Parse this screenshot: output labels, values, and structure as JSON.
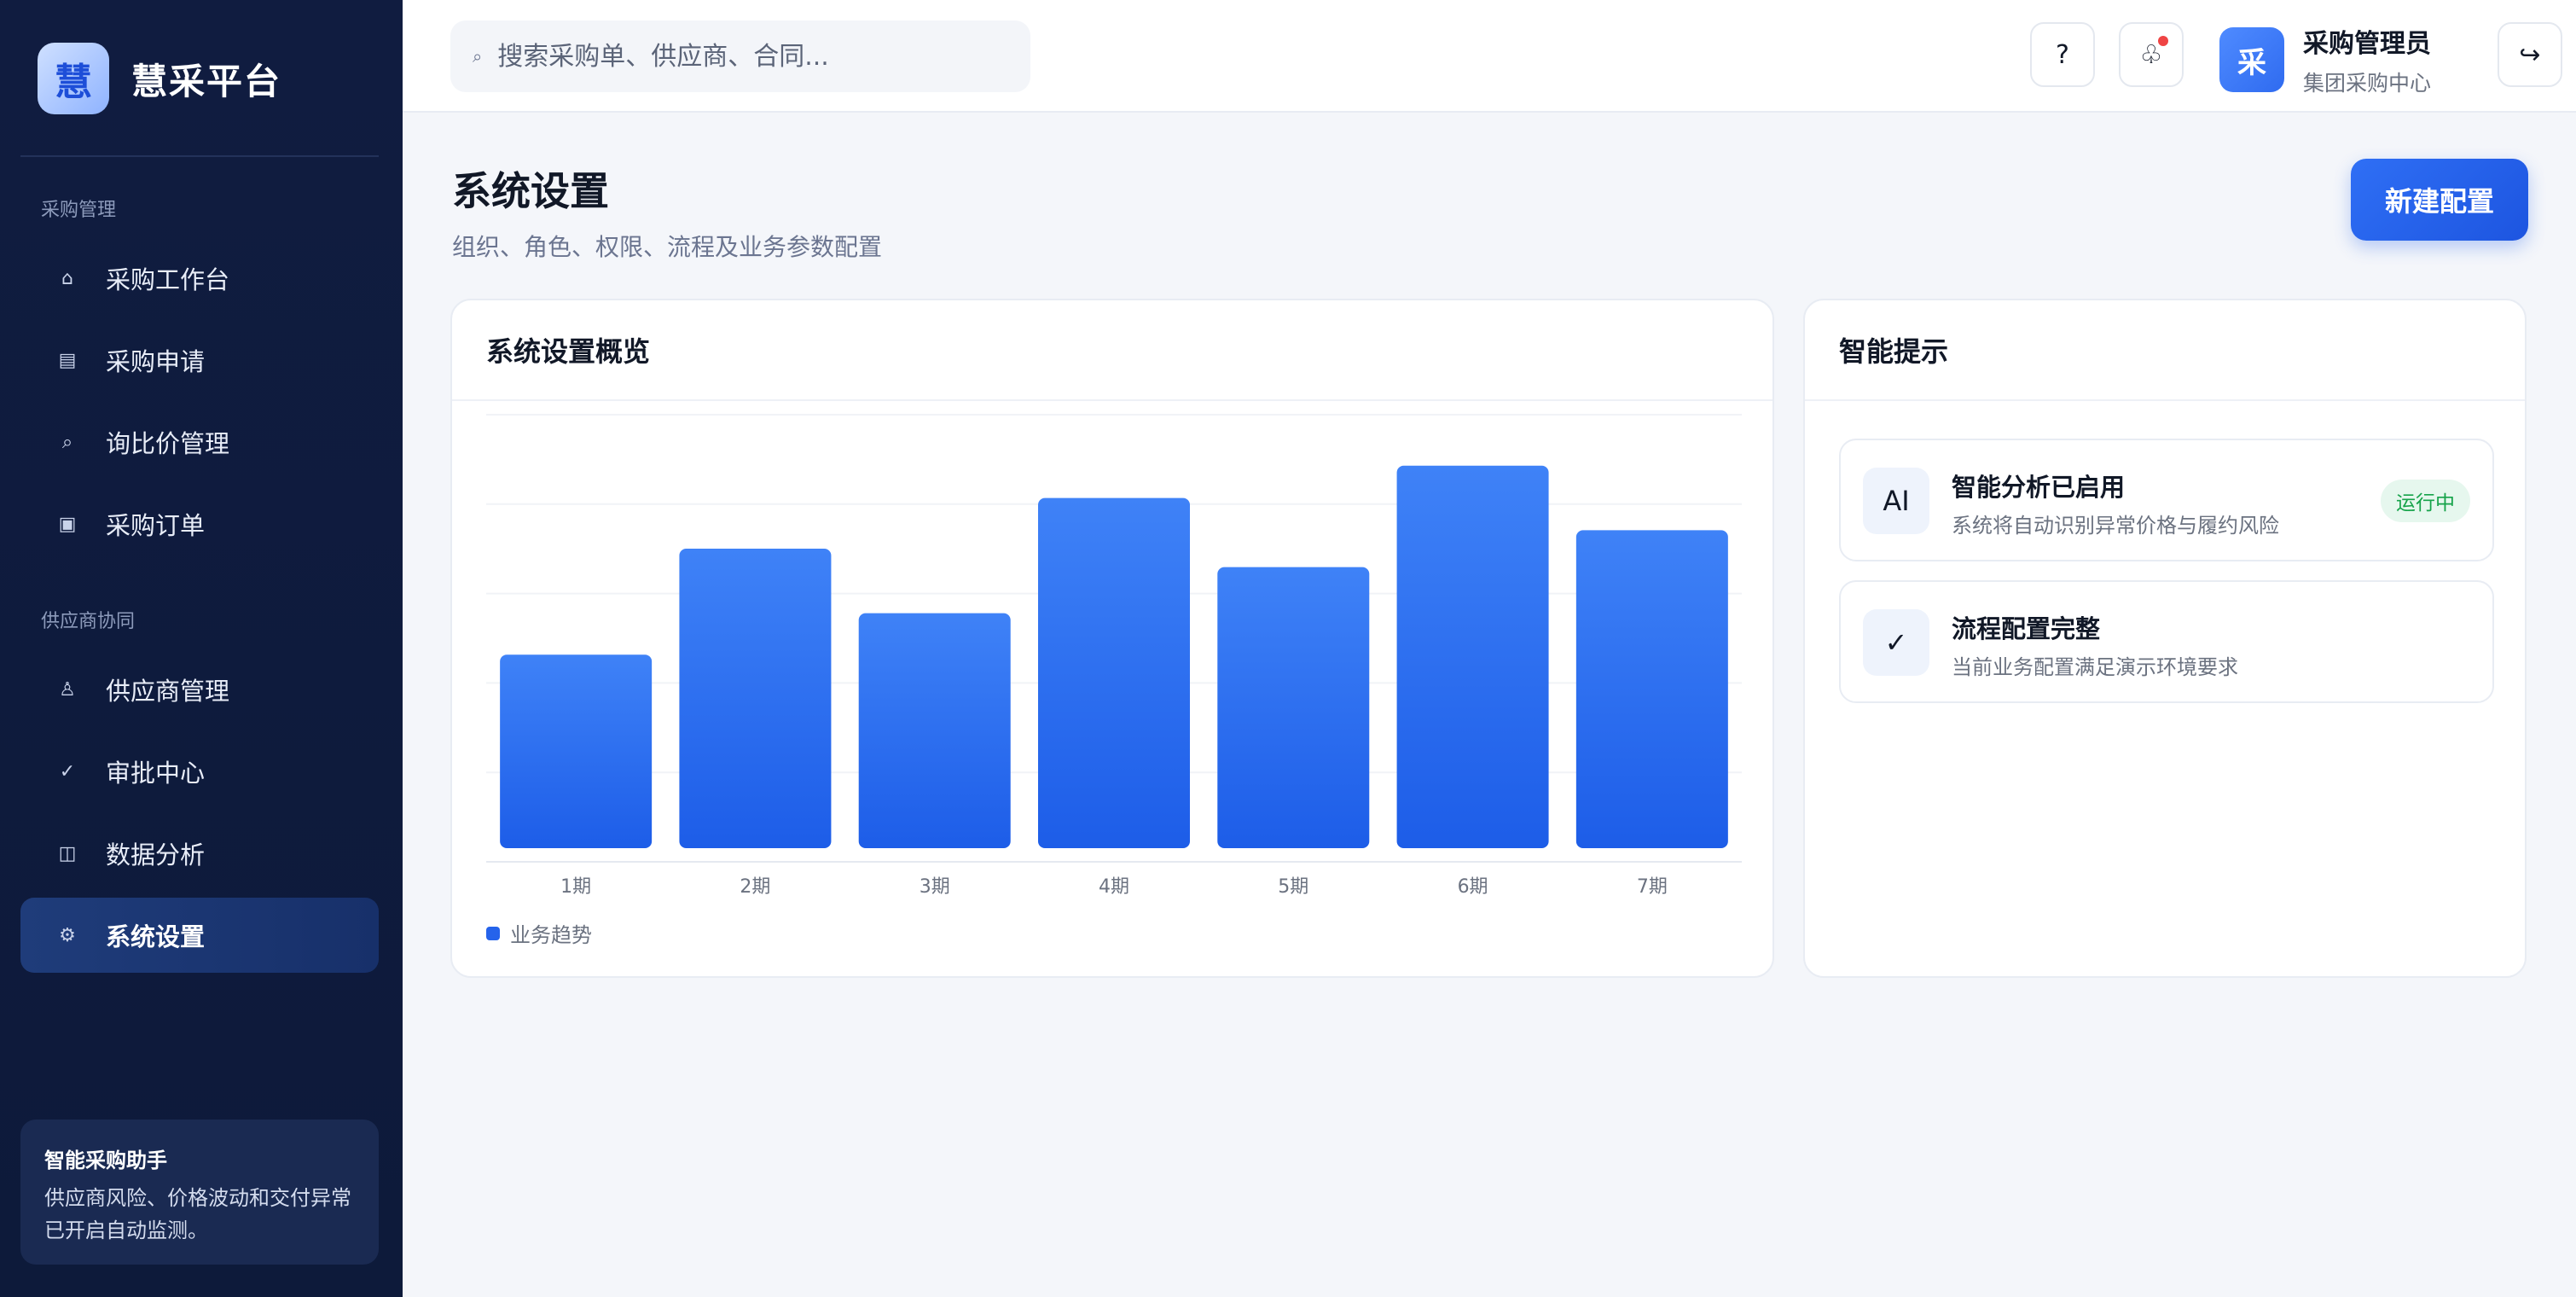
{
  "brand": {
    "logo_char": "慧",
    "name": "慧采平台"
  },
  "sidebar": {
    "sections": [
      {
        "title": "采购管理",
        "items": [
          {
            "label": "采购工作台",
            "icon": "home-icon",
            "glyph": "⌂"
          },
          {
            "label": "采购申请",
            "icon": "document-icon",
            "glyph": "▤"
          },
          {
            "label": "询比价管理",
            "icon": "search-icon",
            "glyph": "⌕"
          },
          {
            "label": "采购订单",
            "icon": "order-icon",
            "glyph": "▣"
          }
        ]
      },
      {
        "title": "供应商协同",
        "items": [
          {
            "label": "供应商管理",
            "icon": "supplier-icon",
            "glyph": "♙"
          },
          {
            "label": "审批中心",
            "icon": "check-icon",
            "glyph": "✓"
          },
          {
            "label": "数据分析",
            "icon": "analytics-icon",
            "glyph": "◫"
          },
          {
            "label": "系统设置",
            "icon": "gear-icon",
            "glyph": "⚙",
            "active": true
          }
        ]
      }
    ],
    "assistant": {
      "title": "智能采购助手",
      "text": "供应商风险、价格波动和交付异常已开启自动监测。"
    }
  },
  "header": {
    "search_placeholder": "搜索采购单、供应商、合同...",
    "help_glyph": "?",
    "notification_glyph": "♧",
    "logout_glyph": "↪",
    "user": {
      "avatar_char": "采",
      "name": "采购管理员",
      "dept": "集团采购中心"
    }
  },
  "main": {
    "title": "系统设置",
    "subtitle": "组织、角色、权限、流程及业务参数配置",
    "primary_button": "新建配置",
    "chart_card_title": "系统设置概览",
    "tips_card_title": "智能提示",
    "tips": [
      {
        "icon": "ai-icon",
        "glyph": "AI",
        "title": "智能分析已启用",
        "desc": "系统将自动识别异常价格与履约风险",
        "badge": "运行中"
      },
      {
        "icon": "checkmark-icon",
        "glyph": "✓",
        "title": "流程配置完整",
        "desc": "当前业务配置满足演示环境要求",
        "badge": ""
      }
    ]
  },
  "colors": {
    "accent": "#2563eb",
    "sidebar_bg": "#0f1c3f",
    "success": "#16a34a"
  },
  "chart_data": {
    "type": "bar",
    "categories": [
      "1期",
      "2期",
      "3期",
      "4期",
      "5期",
      "6期",
      "7期"
    ],
    "series": [
      {
        "name": "业务趋势",
        "values": [
          42,
          65,
          51,
          76,
          61,
          83,
          69
        ]
      }
    ],
    "title": "",
    "xlabel": "",
    "ylabel": "",
    "ylim": [
      0,
      100
    ],
    "grid": true,
    "legend": "bottom-left"
  }
}
